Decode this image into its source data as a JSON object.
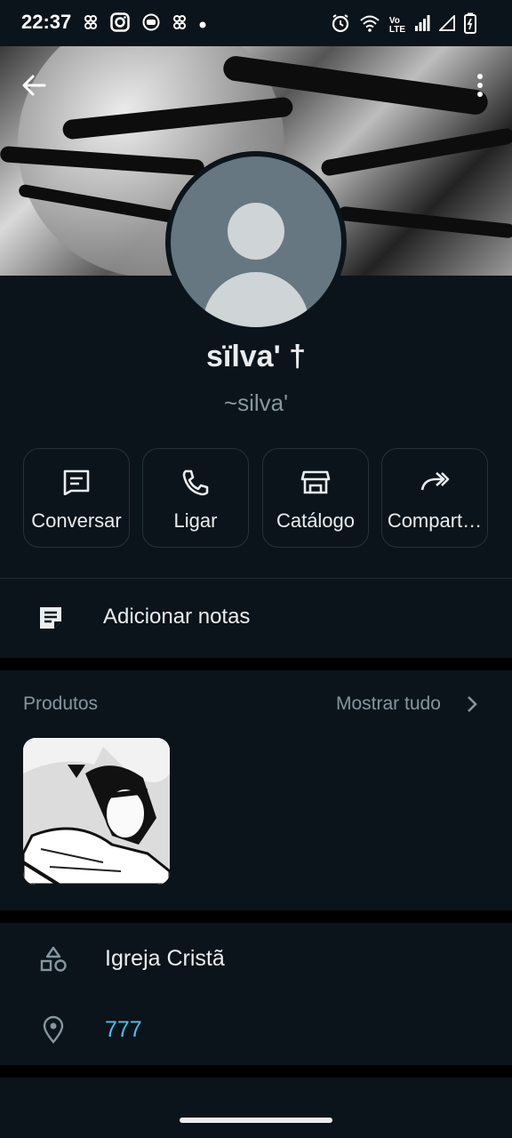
{
  "status_bar": {
    "time": "22:37",
    "left_icons": [
      "app-notification-icon",
      "instagram-icon",
      "youtube-icon",
      "app-notification-icon",
      "dot"
    ],
    "right_icons": [
      "alarm-icon",
      "wifi-icon",
      "volte-icon",
      "signal-icon",
      "signal-icon",
      "battery-icon"
    ],
    "volte_line1": "Vo",
    "volte_line2": "LTE"
  },
  "profile": {
    "name": "sïlva' †",
    "subname": "~silva'"
  },
  "actions": [
    {
      "label": "Conversar",
      "icon": "chat-icon"
    },
    {
      "label": "Ligar",
      "icon": "phone-icon"
    },
    {
      "label": "Catálogo",
      "icon": "store-icon"
    },
    {
      "label": "Compart…",
      "icon": "share-icon"
    }
  ],
  "notes": {
    "label": "Adicionar notas",
    "icon": "note-icon"
  },
  "products": {
    "title": "Produtos",
    "show_all": "Mostrar tudo"
  },
  "info": [
    {
      "label": "Igreja Cristã",
      "icon": "category-icon"
    },
    {
      "label": "777",
      "icon": "location-icon"
    }
  ],
  "colors": {
    "background": "#0b141a",
    "text_primary": "#e9edef",
    "text_secondary": "#8696a0",
    "link": "#53bdeb"
  }
}
